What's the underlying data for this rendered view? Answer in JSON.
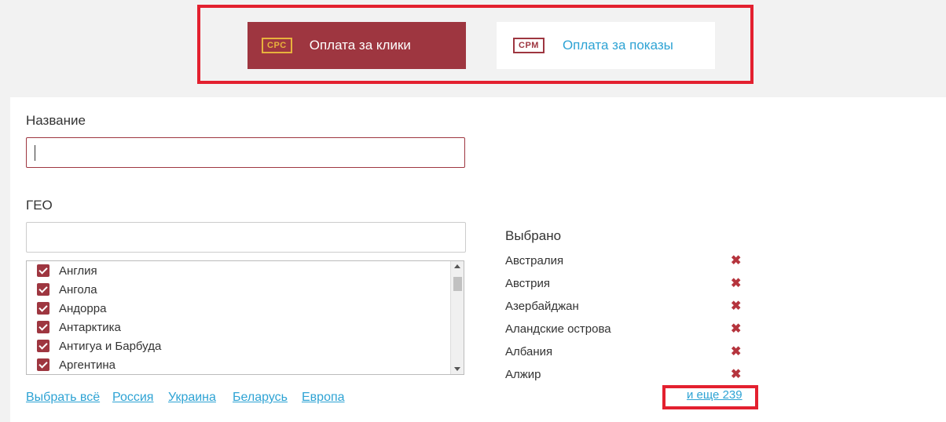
{
  "payment_type": {
    "cpc": {
      "badge": "CPC",
      "label": "Оплата за клики"
    },
    "cpm": {
      "badge": "CPM",
      "label": "Оплата за показы"
    }
  },
  "form": {
    "name_label": "Название",
    "name_value": "",
    "geo_label": "ГЕО",
    "geo_search_value": ""
  },
  "countries": [
    {
      "name": "Англия",
      "checked": true
    },
    {
      "name": "Ангола",
      "checked": true
    },
    {
      "name": "Андорра",
      "checked": true
    },
    {
      "name": "Антарктика",
      "checked": true
    },
    {
      "name": "Антигуа и Барбуда",
      "checked": true
    },
    {
      "name": "Аргентина",
      "checked": true
    }
  ],
  "quick_links": [
    "Выбрать всё",
    "Россия",
    "Украина",
    "Беларусь",
    "Европа"
  ],
  "selected": {
    "title": "Выбрано",
    "items": [
      "Австралия",
      "Австрия",
      "Азербайджан",
      "Аландские острова",
      "Албания",
      "Алжир"
    ],
    "remove_glyph": "✖",
    "more_label": "и еще 239"
  },
  "colors": {
    "accent": "#9e3640",
    "link": "#2ea3d4",
    "badge_cpc": "#e8b23c",
    "highlight": "#e3202f"
  }
}
